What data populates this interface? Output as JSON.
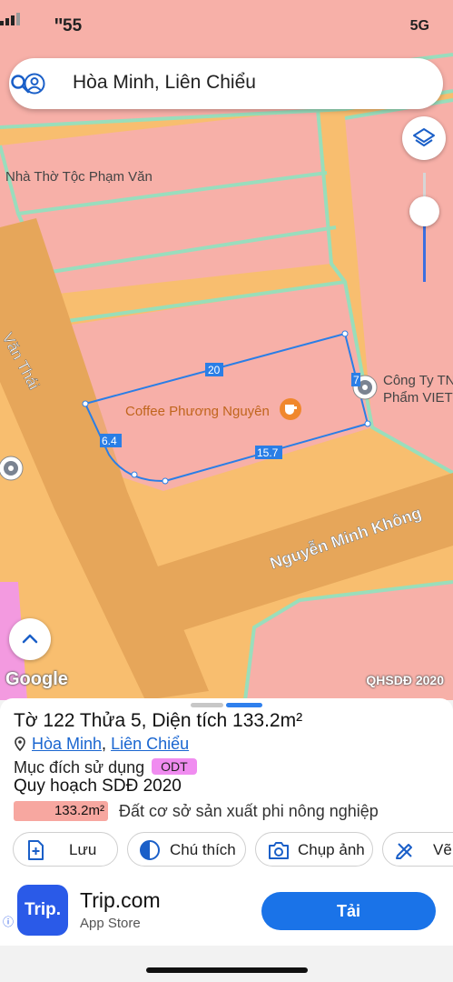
{
  "status_bar": {
    "time": "ꞌꞌ55",
    "network": "5G"
  },
  "search": {
    "query": "Hòa Minh, Liên Chiểu"
  },
  "map": {
    "labels": {
      "church": "Nhà Thờ Tộc Phạm Văn",
      "street_left": "Văn Thái",
      "cafe": "Coffee Phương Nguyên",
      "company_line1": "Công Ty TN",
      "company_line2": "Phẩm VIET",
      "street_main": "Nguyễn Minh Không"
    },
    "dimensions": {
      "top": "20",
      "right": "7",
      "left": "6.4",
      "bottom": "15.7"
    },
    "attribution": "Google",
    "layer_name": "QHSDĐ 2020",
    "colors": {
      "residential": "#f7b0a8",
      "agricultural": "#f8be6f",
      "road": "#e8aa5c",
      "parcel_line": "#2a7ee6"
    }
  },
  "parcel": {
    "title": "Tờ 122 Thửa 5, Diện tích 133.2m²",
    "ward": "Hòa Minh",
    "district": "Liên Chiểu",
    "purpose_label": "Mục đích sử dụng",
    "purpose_code": "ODT",
    "plan_title": "Quy hoạch SDĐ 2020",
    "area_value": "133.2m²",
    "area_description": "Đất cơ sở sản xuất phi nông nghiệp"
  },
  "actions": {
    "save": "Lưu",
    "legend": "Chú thích",
    "capture": "Chụp ảnh",
    "draw": "Vẽ"
  },
  "ad": {
    "logo_text": "Trip.",
    "title": "Trip.com",
    "subtitle": "App Store",
    "cta": "Tải"
  }
}
